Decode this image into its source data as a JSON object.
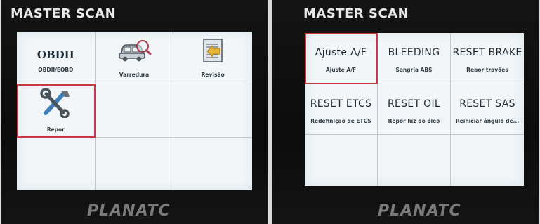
{
  "devices": [
    {
      "title": "MASTER SCAN",
      "logo": "PLANATC",
      "cells": [
        {
          "main": "OBDII",
          "sub": "OBDII/EOBD"
        },
        {
          "icon": "car-magnifier-icon",
          "sub": "Varredura"
        },
        {
          "icon": "document-arrow-icon",
          "sub": "Revisão"
        },
        {
          "icon": "wrench-screwdriver-icon",
          "sub": "Repor",
          "selected": true
        }
      ]
    },
    {
      "title": "MASTER SCAN",
      "logo": "PLANATC",
      "cells": [
        {
          "main": "Ajuste A/F",
          "sub": "Ajuste A/F",
          "selected": true
        },
        {
          "main": "BLEEDING",
          "sub": "Sangria ABS"
        },
        {
          "main": "RESET BRAKE",
          "sub": "Repor travões"
        },
        {
          "main": "RESET ETCS",
          "sub": "Redefinição de ETCS"
        },
        {
          "main": "RESET OIL",
          "sub": "Repor luz do óleo"
        },
        {
          "main": "RESET SAS",
          "sub": "Reiniciar ângulo de..."
        }
      ]
    }
  ],
  "colors": {
    "selection": "#c8393f",
    "screen": "#f3f6f8",
    "bezel": "#111111"
  }
}
